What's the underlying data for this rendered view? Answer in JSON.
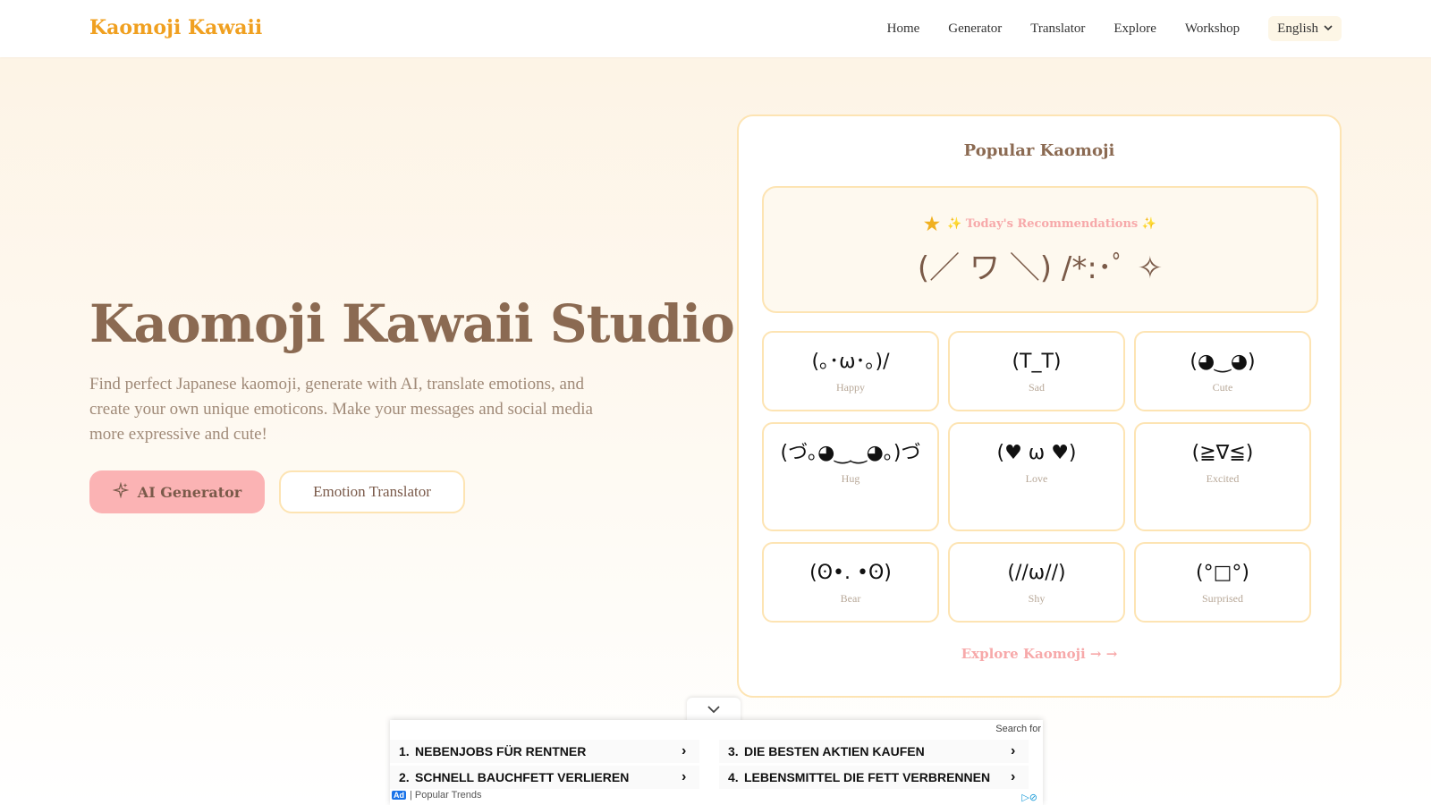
{
  "header": {
    "brand": "Kaomoji Kawaii",
    "nav": [
      "Home",
      "Generator",
      "Translator",
      "Explore",
      "Workshop"
    ],
    "language": "English",
    "language_icon": "chevron-down-icon"
  },
  "hero": {
    "title": "Kaomoji Kawaii Studio",
    "description": "Find perfect Japanese kaomoji, generate with AI, translate emotions, and create your own unique emoticons. Make your messages and social media more expressive and cute!",
    "ai_button": "AI Generator",
    "ai_button_icon": "sparkle-icon",
    "emotion_button": "Emotion Translator"
  },
  "card": {
    "title": "Popular Kaomoji",
    "recommendation_label": "✨ Today's Recommendations ✨",
    "recommendation_icon": "star-icon",
    "recommendation_kaomoji": "(／ ワ ＼) /*:･ﾟ ✧",
    "items": [
      {
        "kaomoji": "(｡･ω･｡)/",
        "label": "Happy"
      },
      {
        "kaomoji": "(T_T)",
        "label": "Sad"
      },
      {
        "kaomoji": "(◕‿◕)",
        "label": "Cute"
      },
      {
        "kaomoji": "(づ｡◕‿‿◕｡)づ",
        "label": "Hug"
      },
      {
        "kaomoji": "(♥ ω ♥)",
        "label": "Love"
      },
      {
        "kaomoji": "(≧∇≦)",
        "label": "Excited"
      },
      {
        "kaomoji": "(ʘ•. •ʘ)",
        "label": "Bear"
      },
      {
        "kaomoji": "(//ω//)",
        "label": "Shy"
      },
      {
        "kaomoji": "(°□°)",
        "label": "Surprised"
      }
    ],
    "explore_link": "Explore Kaomoji → →"
  },
  "ad": {
    "toggle_icon": "chevron-down-icon",
    "search_for": "Search for",
    "rows": [
      {
        "num": "1.",
        "text": "NEBENJOBS FÜR RENTNER"
      },
      {
        "num": "2.",
        "text": "SCHNELL BAUCHFETT VERLIEREN"
      },
      {
        "num": "3.",
        "text": "DIE BESTEN AKTIEN KAUFEN"
      },
      {
        "num": "4.",
        "text": "LEBENSMITTEL DIE FETT VERBRENNEN"
      }
    ],
    "badge": "Ad",
    "footer": "| Popular Trends"
  },
  "colors": {
    "brand": "#f0a020",
    "title": "#8b6a52",
    "accent_pink": "#fbb3b4",
    "border": "#fde4b3"
  }
}
